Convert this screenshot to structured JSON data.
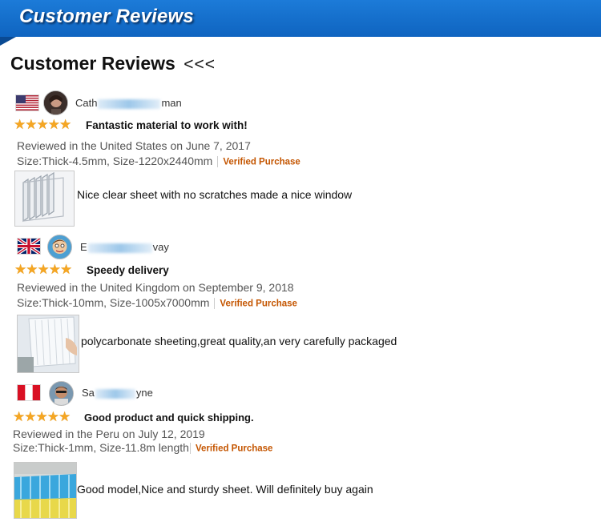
{
  "banner": {
    "title": "Customer Reviews"
  },
  "heading": {
    "text": "Customer Reviews",
    "arrows": "<<<"
  },
  "reviews": [
    {
      "flag": "us-flag-icon",
      "name_start": "Cath",
      "name_end": "man",
      "stars": "★★★★★",
      "title": "Fantastic material to work with!",
      "reviewed": "Reviewed in the United States on June 7, 2017",
      "size": "Size:Thick-4.5mm, Size-1220x2440mm",
      "verified": "Verified Purchase",
      "text": "Nice clear sheet with no scratches made a nice window"
    },
    {
      "flag": "uk-flag-icon",
      "name_start": "E",
      "name_end": "vay",
      "stars": "★★★★★",
      "title": "Speedy delivery",
      "reviewed": "Reviewed in the United Kingdom on September 9, 2018",
      "size": "Size:Thick-10mm, Size-1005x7000mm",
      "verified": "Verified Purchase",
      "text": "polycarbonate sheeting,great quality,an very carefully packaged"
    },
    {
      "flag": "peru-flag-icon",
      "name_start": "Sa",
      "name_end": "yne",
      "stars": "★★★★★",
      "title": "Good product and quick shipping.",
      "reviewed": "Reviewed in the Peru on July 12, 2019",
      "size": "Size:Thick-1mm, Size-11.8m length",
      "verified": "Verified Purchase",
      "text": "Good model,Nice and sturdy sheet. Will definitely buy again"
    }
  ]
}
